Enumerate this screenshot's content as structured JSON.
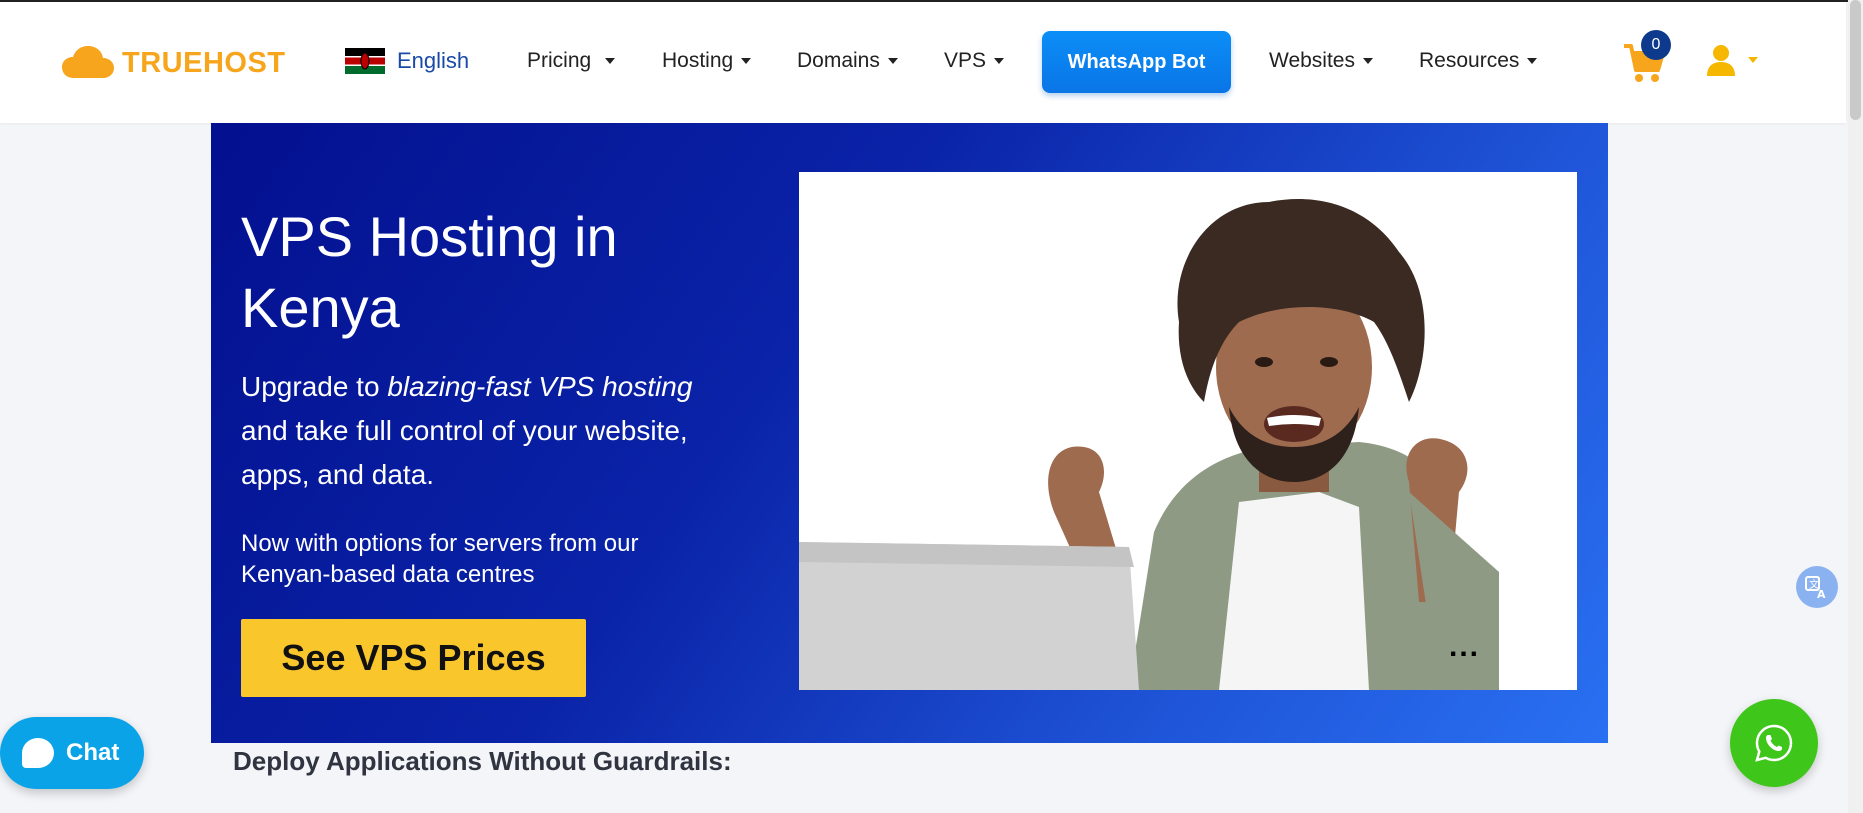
{
  "header": {
    "logo_text": "TRUEHOST",
    "language": "English",
    "nav": [
      {
        "label": "Pricing"
      },
      {
        "label": "Hosting"
      },
      {
        "label": "Domains"
      },
      {
        "label": "VPS"
      }
    ],
    "whatsapp_bot": "WhatsApp Bot",
    "nav_right": [
      {
        "label": "Websites"
      },
      {
        "label": "Resources"
      }
    ],
    "cart_count": "0"
  },
  "hero": {
    "title": "VPS Hosting in Kenya",
    "sub_prefix": "Upgrade to ",
    "sub_emphasis": "blazing-fast VPS hosting",
    "sub_suffix": " and take full control of your website, apps, and data.",
    "sub2": "Now with options for servers from our Kenyan-based data centres",
    "cta": "See VPS Prices",
    "dots": "..."
  },
  "section": {
    "heading": "Deploy Applications Without Guardrails:"
  },
  "floating": {
    "chat_label": "Chat"
  },
  "colors": {
    "brand_orange": "#f7a51c",
    "whatsapp_green": "#3fc61a",
    "cta_yellow": "#f9c72b",
    "hero_blue": "#0a23a8"
  }
}
